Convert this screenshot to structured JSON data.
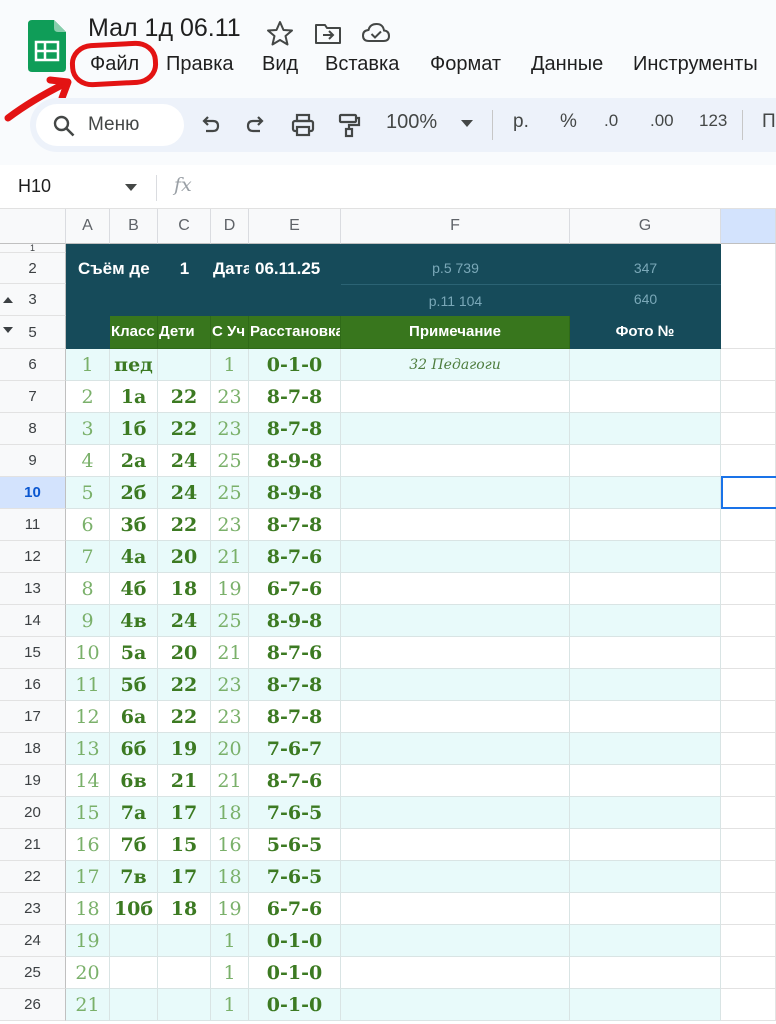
{
  "doc": {
    "title": "Мал 1д 06.11",
    "star_icon": "star-icon",
    "move_icon": "folder-move-icon",
    "cloud_icon": "cloud-saved-icon"
  },
  "menu": {
    "items": [
      "Файл",
      "Правка",
      "Вид",
      "Вставка",
      "Формат",
      "Данные",
      "Инструменты"
    ]
  },
  "toolbar": {
    "search_label": "Меню",
    "zoom": "100%",
    "currency": "р.",
    "percent": "%",
    "dec_decrease": ".0",
    "dec_increase": ".00",
    "format_123": "123",
    "cut_label": "П"
  },
  "formula": {
    "cell_ref": "H10",
    "fx": "fx"
  },
  "grid": {
    "columns": [
      "A",
      "B",
      "C",
      "D",
      "E",
      "F",
      "G"
    ],
    "header_row2": {
      "a": "Съём де",
      "c": "1",
      "d": "Дата",
      "e": "06.11.25",
      "f": "р.5 739",
      "g": "347"
    },
    "header_row3": {
      "f": "р.11 104",
      "g": "640"
    },
    "header_row5": {
      "b": "Класс",
      "c": "Дети",
      "d": "С Уч",
      "e": "Расстановка",
      "f": "Примечание",
      "g": "Фото №"
    },
    "row_numbers_top": [
      "1",
      "2",
      "3",
      "5"
    ],
    "rows": [
      {
        "row": "6",
        "a": "1",
        "b": "пед",
        "c": "",
        "d": "1",
        "e": "0-1-0",
        "f": "32 Педагоги"
      },
      {
        "row": "7",
        "a": "2",
        "b": "1а",
        "c": "22",
        "d": "23",
        "e": "8-7-8",
        "f": ""
      },
      {
        "row": "8",
        "a": "3",
        "b": "1б",
        "c": "22",
        "d": "23",
        "e": "8-7-8",
        "f": ""
      },
      {
        "row": "9",
        "a": "4",
        "b": "2а",
        "c": "24",
        "d": "25",
        "e": "8-9-8",
        "f": ""
      },
      {
        "row": "10",
        "a": "5",
        "b": "2б",
        "c": "24",
        "d": "25",
        "e": "8-9-8",
        "f": ""
      },
      {
        "row": "11",
        "a": "6",
        "b": "3б",
        "c": "22",
        "d": "23",
        "e": "8-7-8",
        "f": ""
      },
      {
        "row": "12",
        "a": "7",
        "b": "4а",
        "c": "20",
        "d": "21",
        "e": "8-7-6",
        "f": ""
      },
      {
        "row": "13",
        "a": "8",
        "b": "4б",
        "c": "18",
        "d": "19",
        "e": "6-7-6",
        "f": ""
      },
      {
        "row": "14",
        "a": "9",
        "b": "4в",
        "c": "24",
        "d": "25",
        "e": "8-9-8",
        "f": ""
      },
      {
        "row": "15",
        "a": "10",
        "b": "5а",
        "c": "20",
        "d": "21",
        "e": "8-7-6",
        "f": ""
      },
      {
        "row": "16",
        "a": "11",
        "b": "5б",
        "c": "22",
        "d": "23",
        "e": "8-7-8",
        "f": ""
      },
      {
        "row": "17",
        "a": "12",
        "b": "6а",
        "c": "22",
        "d": "23",
        "e": "8-7-8",
        "f": ""
      },
      {
        "row": "18",
        "a": "13",
        "b": "6б",
        "c": "19",
        "d": "20",
        "e": "7-6-7",
        "f": ""
      },
      {
        "row": "19",
        "a": "14",
        "b": "6в",
        "c": "21",
        "d": "21",
        "e": "8-7-6",
        "f": ""
      },
      {
        "row": "20",
        "a": "15",
        "b": "7а",
        "c": "17",
        "d": "18",
        "e": "7-6-5",
        "f": ""
      },
      {
        "row": "21",
        "a": "16",
        "b": "7б",
        "c": "15",
        "d": "16",
        "e": "5-6-5",
        "f": ""
      },
      {
        "row": "22",
        "a": "17",
        "b": "7в",
        "c": "17",
        "d": "18",
        "e": "7-6-5",
        "f": ""
      },
      {
        "row": "23",
        "a": "18",
        "b": "10б",
        "c": "18",
        "d": "19",
        "e": "6-7-6",
        "f": ""
      },
      {
        "row": "24",
        "a": "19",
        "b": "",
        "c": "",
        "d": "1",
        "e": "0-1-0",
        "f": ""
      },
      {
        "row": "25",
        "a": "20",
        "b": "",
        "c": "",
        "d": "1",
        "e": "0-1-0",
        "f": ""
      },
      {
        "row": "26",
        "a": "21",
        "b": "",
        "c": "",
        "d": "1",
        "e": "0-1-0",
        "f": ""
      }
    ],
    "selected_row": "10",
    "selected_cell": "H10"
  }
}
